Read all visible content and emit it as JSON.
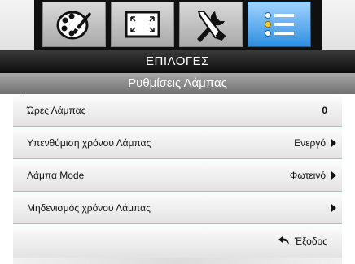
{
  "tabs": [
    {
      "icon": "palette-icon"
    },
    {
      "icon": "display-aspect-icon"
    },
    {
      "icon": "tools-icon"
    },
    {
      "icon": "options-list-icon",
      "active": true
    }
  ],
  "header": {
    "title": "ΕΠΙΛΟΓΕΣ"
  },
  "subheader": {
    "title": "Ρυθμίσεις Λάμπας"
  },
  "rows": [
    {
      "label": "Ώρες Λάμπας",
      "value": "0"
    },
    {
      "label": "Υπενθύμιση χρόνου Λάμπας",
      "value": "Ενεργό"
    },
    {
      "label": "Λάμπα Mode",
      "value": "Φωτεινό"
    },
    {
      "label": "Μηδενισμός χρόνου Λάμπας",
      "value": ""
    },
    {
      "label": "",
      "value": "Έξοδος"
    }
  ],
  "colors": {
    "accent": "#2f8fe0",
    "row_divider": "#8ec4ec"
  }
}
